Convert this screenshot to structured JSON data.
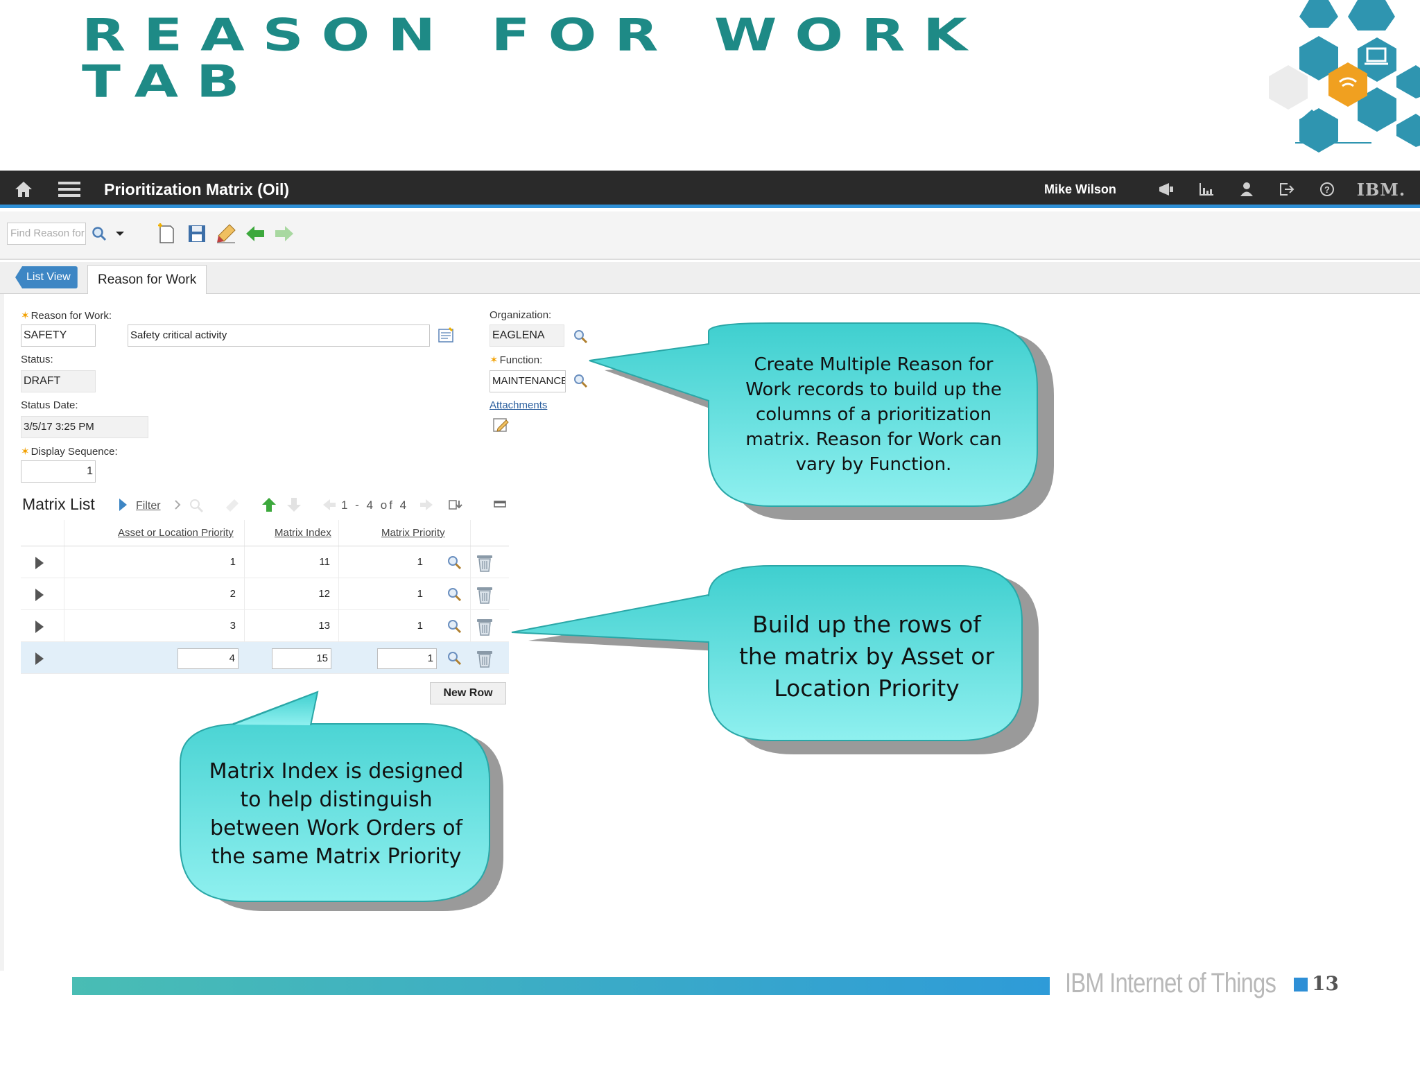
{
  "slide": {
    "title_line1": "REASON FOR WORK",
    "title_line2": "TAB",
    "footer_brand": "IBM Internet of Things",
    "page_number": "13"
  },
  "topbar": {
    "app_title": "Prioritization Matrix (Oil)",
    "user_name": "Mike Wilson",
    "logo_text": "IBM."
  },
  "toolbar": {
    "search_placeholder": "Find Reason for Work"
  },
  "tabs": {
    "list_view": "List View",
    "reason_for_work": "Reason for Work"
  },
  "form": {
    "reason_label": "Reason for Work:",
    "reason_code": "SAFETY",
    "reason_description": "Safety critical activity",
    "status_label": "Status:",
    "status_value": "DRAFT",
    "status_date_label": "Status Date:",
    "status_date_value": "3/5/17 3:25 PM",
    "display_sequence_label": "Display Sequence:",
    "display_sequence_value": "1",
    "organization_label": "Organization:",
    "organization_value": "EAGLENA",
    "function_label": "Function:",
    "function_value": "MAINTENANCE",
    "attachments_label": "Attachments"
  },
  "matrix_list": {
    "title": "Matrix List",
    "filter_label": "Filter",
    "pager": "1 - 4 of 4",
    "columns": [
      "Asset or Location Priority",
      "Matrix Index",
      "Matrix Priority"
    ],
    "rows": [
      {
        "asset_priority": "1",
        "matrix_index": "11",
        "matrix_priority": "1"
      },
      {
        "asset_priority": "2",
        "matrix_index": "12",
        "matrix_priority": "1"
      },
      {
        "asset_priority": "3",
        "matrix_index": "13",
        "matrix_priority": "1"
      },
      {
        "asset_priority": "4",
        "matrix_index": "15",
        "matrix_priority": "1"
      }
    ],
    "new_row_label": "New Row"
  },
  "callouts": {
    "columns_note": "Create Multiple Reason for Work records to build up the columns of a prioritization matrix. Reason for Work can vary by Function.",
    "rows_note": "Build up the rows of the matrix by Asset or Location Priority",
    "index_note": "Matrix Index is designed to help distinguish between Work Orders of the same Matrix Priority"
  },
  "colors": {
    "title_teal": "#1e8a86",
    "callout_fill": "#56d6d6",
    "topbar_bg": "#2a2a2a",
    "accent_blue": "#2e8fd6",
    "hex_teal": "#2f95b0",
    "hex_orange": "#f0a020"
  }
}
